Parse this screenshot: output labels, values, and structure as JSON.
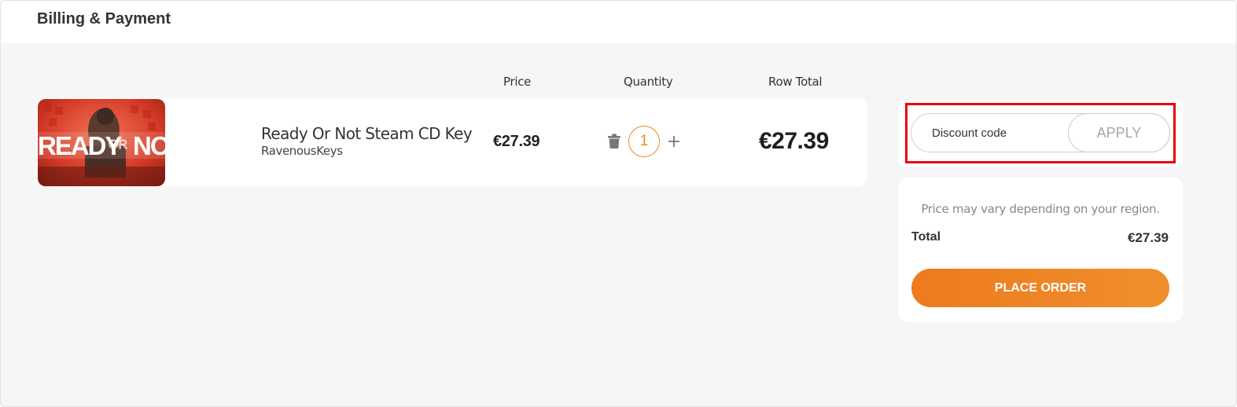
{
  "header": {
    "title": "Billing & Payment"
  },
  "columns": {
    "price": "Price",
    "quantity": "Quantity",
    "row_total": "Row Total"
  },
  "cart_item": {
    "image_text": {
      "ready": "READY",
      "or": "OR",
      "not": "NOT"
    },
    "name": "Ready Or Not Steam CD Key",
    "seller": "RavenousKeys",
    "price": "€27.39",
    "quantity": "1",
    "row_total": "€27.39",
    "icons": {
      "delete": "trash-icon",
      "increase": "plus-icon"
    }
  },
  "discount": {
    "placeholder": "Discount code",
    "apply_label": "APPLY"
  },
  "summary": {
    "note": "Price may vary depending on your region.",
    "total_label": "Total",
    "total_value": "€27.39",
    "place_order_label": "PLACE ORDER"
  },
  "colors": {
    "accent": "#f08a28",
    "highlight": "#e8000b",
    "background": "#f6f6f6"
  }
}
